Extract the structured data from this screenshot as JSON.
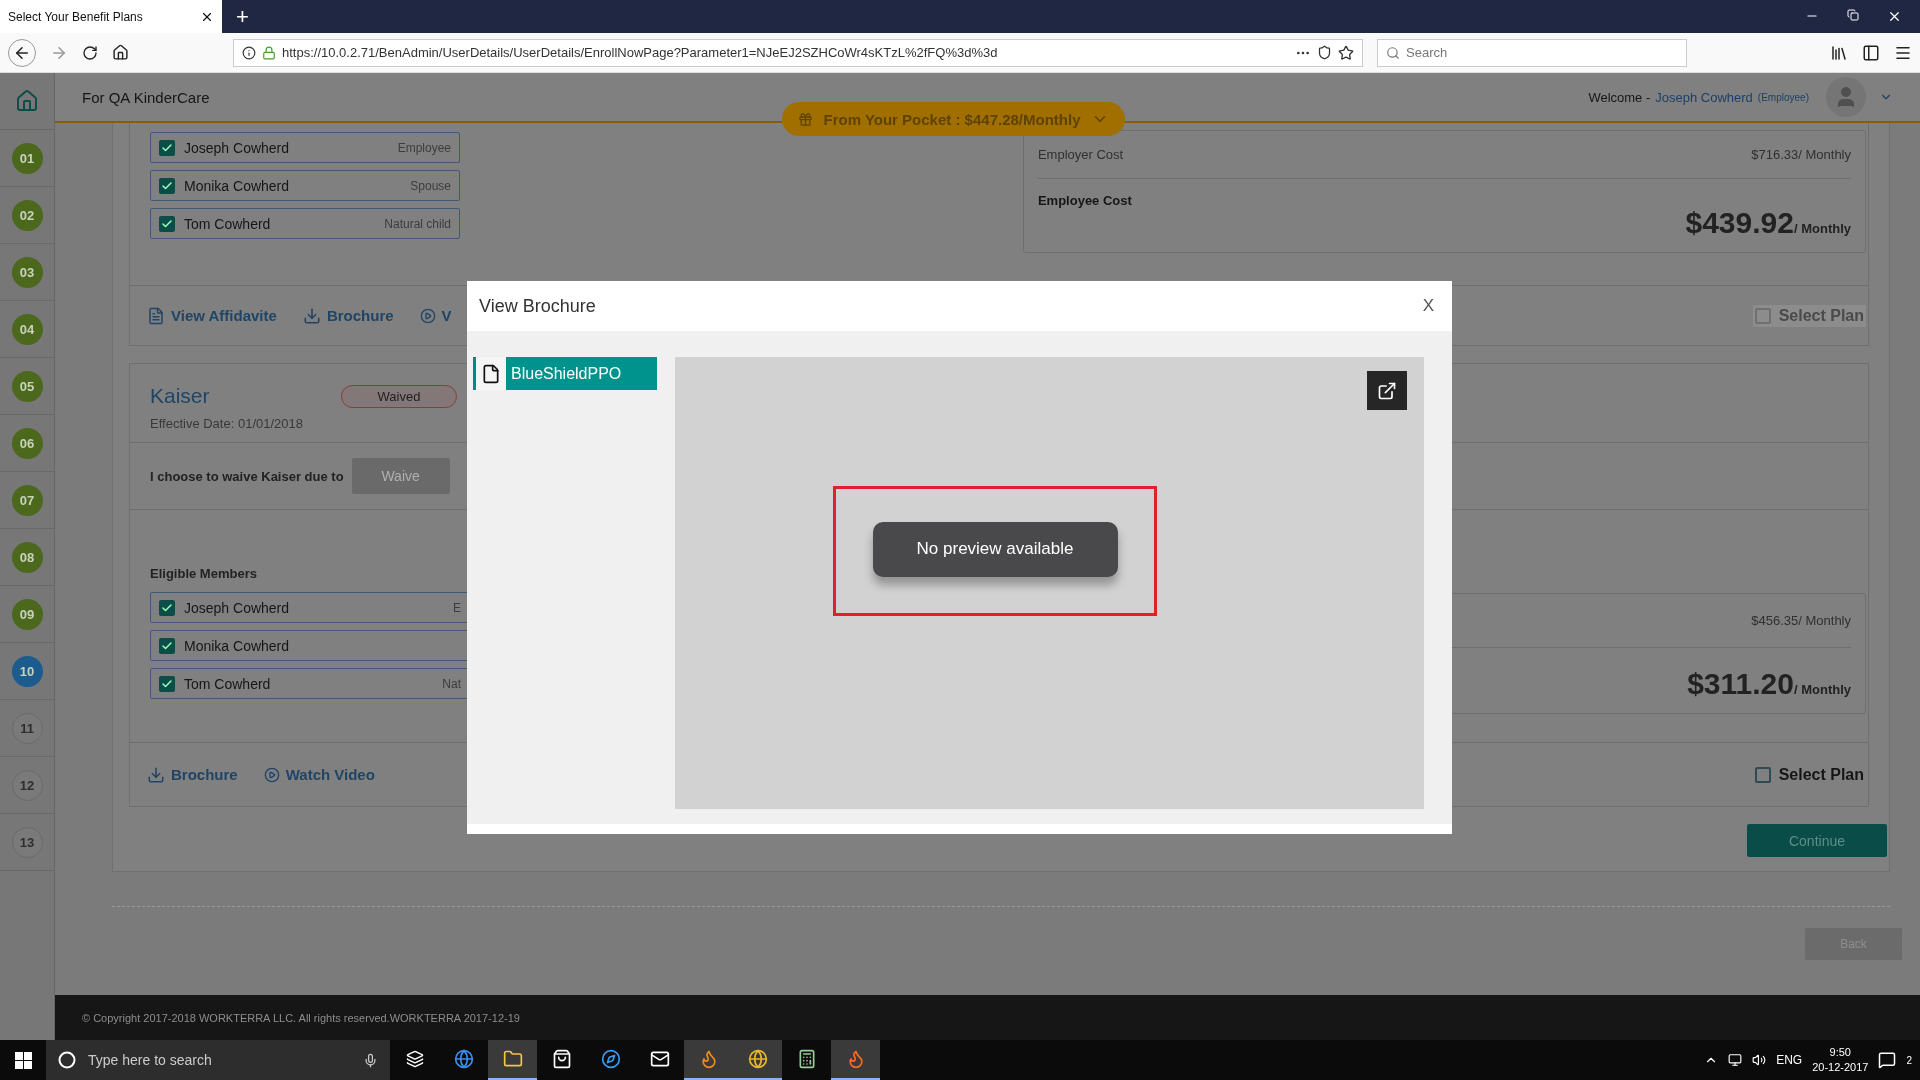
{
  "browser": {
    "tab_title": "Select Your Benefit Plans",
    "new_tab": "+",
    "url": "https://10.0.2.71/BenAdmin/UserDetails/UserDetails/EnrollNowPage?Parameter1=NJeEJ2SZHCoWr4sKTzL%2fFQ%3d%3d",
    "search_placeholder": "Search"
  },
  "header": {
    "company": "For QA KinderCare",
    "pocket": "From Your Pocket : $447.28/Monthly",
    "welcome": "Welcome -",
    "user": "Joseph Cowherd",
    "role": "(Employee)"
  },
  "steps": [
    {
      "label": "01",
      "completed": true,
      "selected": false
    },
    {
      "label": "02",
      "completed": true,
      "selected": false
    },
    {
      "label": "03",
      "completed": true,
      "selected": false
    },
    {
      "label": "04",
      "completed": true,
      "selected": false
    },
    {
      "label": "05",
      "completed": true,
      "selected": false
    },
    {
      "label": "06",
      "completed": true,
      "selected": false
    },
    {
      "label": "07",
      "completed": true,
      "selected": false
    },
    {
      "label": "08",
      "completed": true,
      "selected": false
    },
    {
      "label": "09",
      "completed": true,
      "selected": false
    },
    {
      "label": "10",
      "completed": false,
      "selected": true
    },
    {
      "label": "11",
      "completed": false,
      "selected": false
    },
    {
      "label": "12",
      "completed": false,
      "selected": false
    },
    {
      "label": "13",
      "completed": false,
      "selected": false
    }
  ],
  "plans": [
    {
      "members": [
        {
          "name": "Joseph Cowherd",
          "role": "Employee",
          "checked": true
        },
        {
          "name": "Monika Cowherd",
          "role": "Spouse",
          "checked": true
        },
        {
          "name": "Tom Cowherd",
          "role": "Natural child",
          "checked": true
        }
      ],
      "costs": {
        "employer_label": "Employer Cost",
        "employer_value": "$716.33/ Monthly",
        "employee_label": "Employee Cost",
        "employee_amount": "$439.92",
        "employee_unit": "/ Monthly"
      },
      "actions": [
        {
          "kind": "affidavit",
          "label": "View Affidavite"
        },
        {
          "kind": "download",
          "label": "Brochure"
        },
        {
          "kind": "video",
          "label": "V"
        }
      ],
      "select_plan": {
        "label": "Select Plan",
        "checked": false,
        "disabled": true
      }
    },
    {
      "title": "Kaiser",
      "status": "Waived",
      "effective": "Effective Date: 01/01/2018",
      "waive_text": "I choose to waive Kaiser due to",
      "waive_button": {
        "label": "Waive",
        "disabled": true
      },
      "eligible_label": "Eligible Members",
      "members": [
        {
          "name": "Joseph Cowherd",
          "role": "E",
          "checked": true
        },
        {
          "name": "Monika Cowherd",
          "checked": true
        },
        {
          "name": "Tom Cowherd",
          "role": "Nat",
          "checked": true
        }
      ],
      "costs": {
        "employer_value": "$456.35/ Monthly",
        "employee_amount": "$311.20",
        "employee_unit": "/ Monthly"
      },
      "actions": [
        {
          "kind": "download",
          "label": "Brochure"
        },
        {
          "kind": "video",
          "label": "Watch Video"
        }
      ],
      "select_plan": {
        "label": "Select Plan",
        "checked": false,
        "disabled": false
      }
    }
  ],
  "continue": "Continue",
  "back": "Back",
  "footer": "© Copyright 2017-2018 WORKTERRA LLC. All rights reserved.WORKTERRA 2017-12-19",
  "modal": {
    "title": "View Brochure",
    "close": "X",
    "files": [
      {
        "name": "BlueShieldPPO",
        "selected": true
      }
    ],
    "message": "No preview available"
  },
  "taskbar": {
    "search_placeholder": "Type here to search",
    "lang": "ENG",
    "time": "9:50",
    "date": "20-12-2017",
    "notifications": "2"
  }
}
